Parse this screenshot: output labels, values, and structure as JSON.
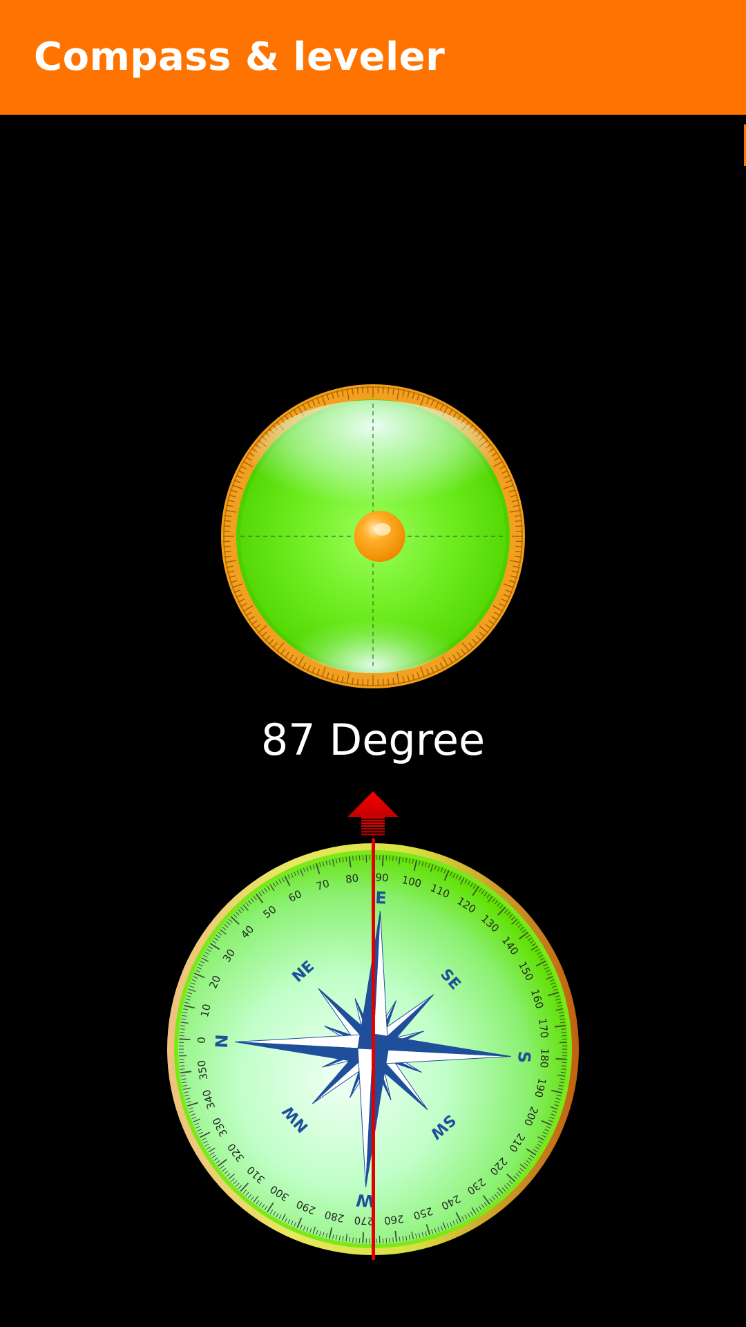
{
  "app": {
    "title": "Compass & leveler"
  },
  "leveler": {
    "bubble_offset": [
      0.05,
      0.0
    ]
  },
  "readout": {
    "degree_text": "87 Degree"
  },
  "compass": {
    "heading_deg": 87,
    "cardinals": {
      "north": "N",
      "east": "E",
      "south": "S",
      "west": "W",
      "northeast": "NE",
      "southeast": "SE",
      "southwest": "SW",
      "northwest": "NW"
    },
    "scale_labels": [
      "0",
      "10",
      "20",
      "30",
      "40",
      "50",
      "60",
      "70",
      "80",
      "90",
      "100",
      "110",
      "120",
      "130",
      "140",
      "150",
      "160",
      "170",
      "180",
      "190",
      "200",
      "210",
      "220",
      "230",
      "240",
      "250",
      "260",
      "270",
      "280",
      "290",
      "300",
      "310",
      "320",
      "330",
      "340",
      "350"
    ]
  },
  "colors": {
    "app_bar": "#FF7300",
    "background": "#000000",
    "dial_green": "#66E600",
    "rose_blue": "#1F4E9B",
    "needle_red": "#E00000",
    "bubble_orange": "#FF9A00"
  },
  "icons": {
    "heading_arrow": "arrow-up-icon",
    "bubble": "level-bubble-icon"
  }
}
